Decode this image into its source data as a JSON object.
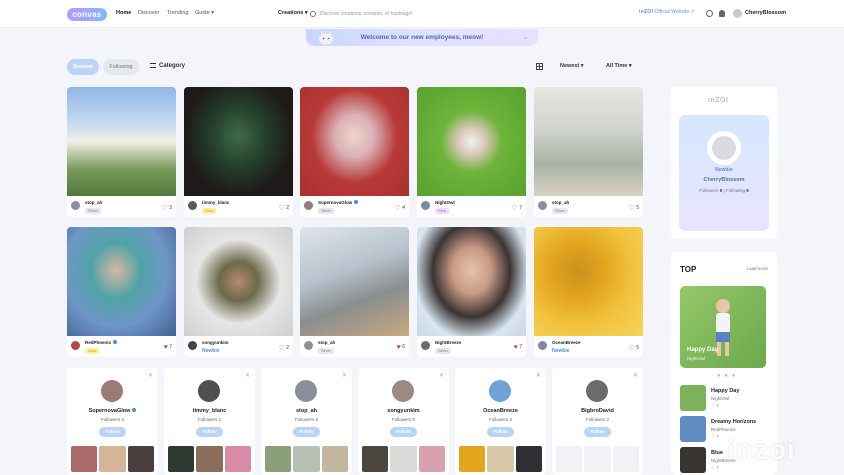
{
  "header": {
    "logo": "convas",
    "nav": [
      "Home",
      "Discover",
      "Trending",
      "Guide"
    ],
    "creations": "Creations",
    "search_placeholder": "Discover creations, creators, or hashtags!",
    "brand_link_brand": "inZOI",
    "brand_link_text": "Official Website",
    "username": "CherryBlossom"
  },
  "banner": {
    "text": "Welcome to our new employees, meow!"
  },
  "filters": {
    "browse": "Browse",
    "following": "Following",
    "category": "Category",
    "sort": "Newest",
    "period": "All Time"
  },
  "cards": [
    {
      "creator": "stop_ah",
      "badge": "Silver",
      "badge_type": "silver",
      "likes": "3",
      "liked": false,
      "verified": false,
      "img": "linear-gradient(180deg,#8fb6e8 0%,#c9dcef 35%,#f2efe6 50%,#7a9b5c 75%,#4f7a3a 100%)",
      "av": "#8a8f99"
    },
    {
      "creator": "timmy_blanc",
      "badge": "Gold",
      "badge_type": "gold",
      "likes": "2",
      "liked": false,
      "verified": false,
      "img": "radial-gradient(ellipse at 50% 45%,#3f6b4a 0%,#25402c 35%,#1e1a1a 70%)",
      "av": "#5a5a5a"
    },
    {
      "creator": "SupernovaGlow",
      "badge": "Silver",
      "badge_type": "silver",
      "likes": "4",
      "liked": false,
      "verified": true,
      "img": "radial-gradient(ellipse at 50% 45%,#f0d5cc 0%,#d9b0b6 25%,#b83a38 55%,#a8302e 100%)",
      "av": "#9a7b76"
    },
    {
      "creator": "NightOwl",
      "badge": "Pink",
      "badge_type": "pink",
      "likes": "7",
      "liked": false,
      "verified": false,
      "img": "radial-gradient(ellipse at 50% 50%,#f2f2f2 0%,#d8c6b6 18%,#6cb43a 40%,#5aa02e 100%)",
      "av": "#7d8a9e"
    },
    {
      "creator": "stop_ah",
      "badge": "Silver",
      "badge_type": "silver",
      "likes": "5",
      "liked": false,
      "verified": false,
      "img": "linear-gradient(180deg,#e8e6df 0%,#cfd3cc 40%,#a7b3a6 70%,#d9d2c4 100%)",
      "av": "#8a8f99"
    },
    {
      "creator": "RedPhoenix",
      "badge": "Gold",
      "badge_type": "gold",
      "likes": "7",
      "liked": true,
      "verified": true,
      "img": "radial-gradient(ellipse at 45% 40%,#d9b7a4 0%,#4fa3a6 30%,#6f96c7 60%,#3e5f93 100%)",
      "av": "#b04848"
    },
    {
      "creator": "songyunkim",
      "badge": "Newbie",
      "badge_type": "newbie",
      "likes": "2",
      "liked": false,
      "verified": false,
      "img": "radial-gradient(ellipse at 50% 50%,#b5896e 0%,#6c6a4a 25%,#e6e6e6 55%,#cfcfcf 100%)",
      "av": "#444"
    },
    {
      "creator": "stop_ah",
      "badge": "Silver",
      "badge_type": "silver",
      "likes": "6",
      "liked": true,
      "verified": false,
      "img": "linear-gradient(160deg,#dfe6ec 0%,#b7c2cc 40%,#8a8e8f 65%,#c8a880 100%)",
      "av": "#8a8f99"
    },
    {
      "creator": "NightBreeze",
      "badge": "Silver",
      "badge_type": "silver",
      "likes": "7",
      "liked": true,
      "verified": false,
      "img": "radial-gradient(ellipse at 50% 40%,#e7c3ad 0%,#c89a84 25%,#3a3433 50%,#d8e6f1 75%,#c8d6e6 100%)",
      "av": "#6b6b6b"
    },
    {
      "creator": "OceanBreeze",
      "badge": "Newbie",
      "badge_type": "newbie",
      "likes": "5",
      "liked": false,
      "verified": false,
      "img": "radial-gradient(ellipse at 40% 40%,#c9911d 0%,#e3a51e 30%,#f1c33e 60%,#f6d35a 100%)",
      "av": "#7b8aa0"
    }
  ],
  "follow_cards": [
    {
      "name": "SupernovaGlow",
      "verified": true,
      "followers": "Followers 2",
      "button": "Follow",
      "av": "#9a7b76",
      "thumbs": [
        "#a96b6b",
        "#d6b49a",
        "#4a3f3f"
      ]
    },
    {
      "name": "timmy_blanc",
      "verified": false,
      "followers": "Followers 2",
      "button": "Follow",
      "av": "#4f4f4f",
      "thumbs": [
        "#2e3a31",
        "#8a6e5a",
        "#d98aa6"
      ]
    },
    {
      "name": "stop_ah",
      "verified": false,
      "followers": "Followers 6",
      "button": "Follow",
      "av": "#8a8f99",
      "thumbs": [
        "#8aa07a",
        "#b8c0b4",
        "#c3b7a2"
      ]
    },
    {
      "name": "songyunkim",
      "verified": false,
      "followers": "Followers 5",
      "button": "Follow",
      "av": "#9c8a80",
      "thumbs": [
        "#4b4640",
        "#d9d9d9",
        "#d9a1b0"
      ]
    },
    {
      "name": "OceanBreeze",
      "verified": false,
      "followers": "Followers 4",
      "button": "Follow",
      "av": "#6fa2d6",
      "thumbs": [
        "#e3a51e",
        "#d7c8a8",
        "#2e2e33"
      ]
    },
    {
      "name": "BigbroDavid",
      "verified": false,
      "followers": "Followers 2",
      "button": "Follow",
      "av": "#6b6b6b",
      "thumbs": [
        "#f1f2f5",
        "#f1f2f5",
        "#f1f2f5"
      ]
    }
  ],
  "profile_panel": {
    "logo": "inZOI",
    "badge": "Newbie",
    "name": "CherryBlossom",
    "followers_label": "Followers",
    "followers": "0",
    "following_label": "Following",
    "following": "5"
  },
  "top_panel": {
    "title": "TOP",
    "more": "Load more",
    "feature_title": "Happy Day",
    "feature_sub": "NightOwl",
    "dots": "● ● ●",
    "rows": [
      {
        "title": "Happy Day",
        "creator": "NightOwl",
        "likes": "♡ 7",
        "color": "#7db25a"
      },
      {
        "title": "Dreamy Horizons",
        "creator": "RedPhoenix",
        "likes": "♡ 7",
        "color": "#5f8cc2"
      },
      {
        "title": "Blue",
        "creator": "NightBreeze",
        "likes": "♡ 7",
        "color": "#3a3433"
      }
    ]
  },
  "watermark": "inzoi"
}
